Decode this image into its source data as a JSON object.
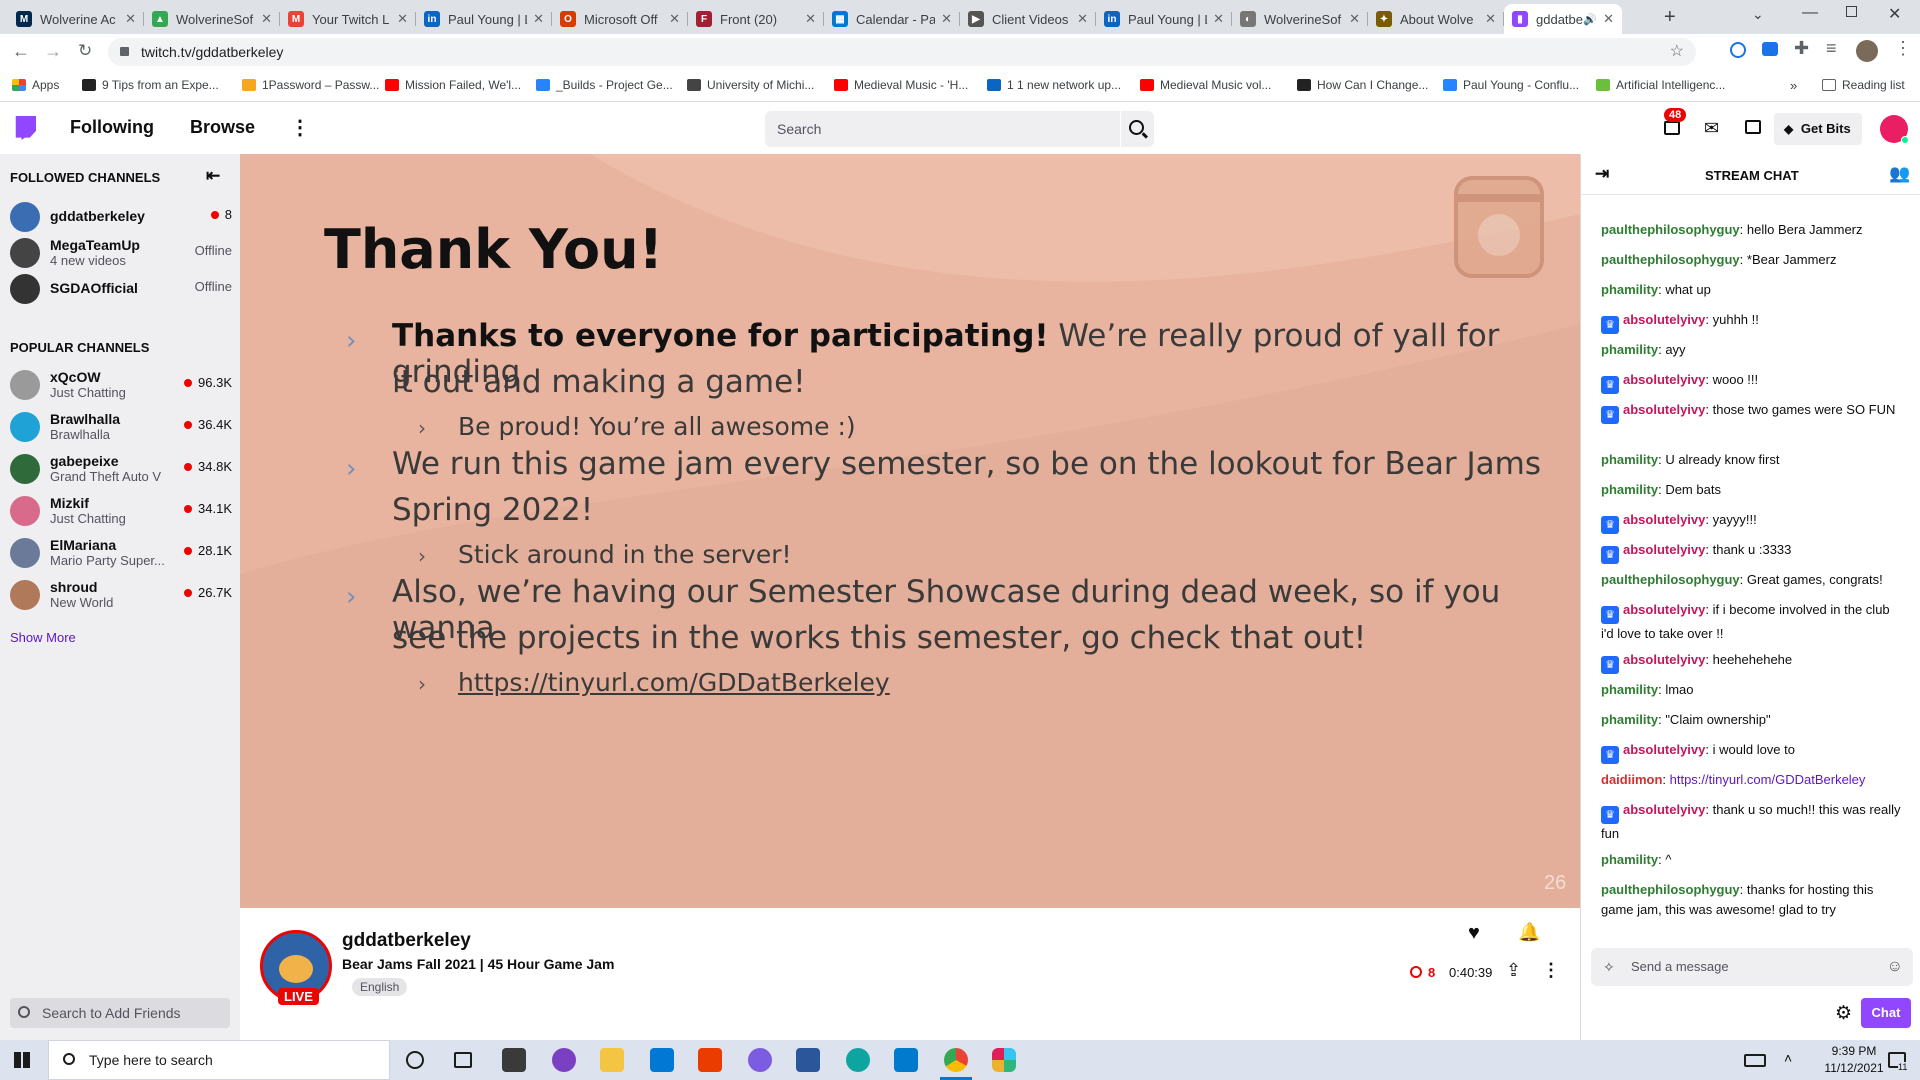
{
  "browser": {
    "tabs": [
      {
        "title": "Wolverine Ac",
        "color": "#00274c",
        "glyph": "M"
      },
      {
        "title": "WolverineSof",
        "color": "#34a853",
        "glyph": "▲"
      },
      {
        "title": "Your Twitch L",
        "color": "#ea4335",
        "glyph": "M"
      },
      {
        "title": "Paul Young | L",
        "color": "#0a66c2",
        "glyph": "in"
      },
      {
        "title": "Microsoft Off",
        "color": "#d83b01",
        "glyph": "O"
      },
      {
        "title": "Front (20)",
        "color": "#a31f34",
        "glyph": "F"
      },
      {
        "title": "Calendar - Pa",
        "color": "#0078d4",
        "glyph": "▦"
      },
      {
        "title": "Client Videos",
        "color": "#555555",
        "glyph": "▶"
      },
      {
        "title": "Paul Young | L",
        "color": "#0a66c2",
        "glyph": "in"
      },
      {
        "title": "WolverineSof",
        "color": "#777777",
        "glyph": "◐"
      },
      {
        "title": "About Wolve",
        "color": "#7a5c00",
        "glyph": "✦"
      },
      {
        "title": "gddatbe",
        "color": "#9147ff",
        "glyph": "▮"
      }
    ],
    "url": "twitch.tv/gddatberkeley",
    "apps_label": "Apps",
    "bookmarks": [
      {
        "label": "9 Tips from an Expe...",
        "color": "#222222"
      },
      {
        "label": "1Password – Passw...",
        "color": "#f5a623"
      },
      {
        "label": "Mission Failed, We'l...",
        "color": "#ff0000"
      },
      {
        "label": "_Builds - Project Ge...",
        "color": "#2684ff"
      },
      {
        "label": "University of Michi...",
        "color": "#444444"
      },
      {
        "label": "Medieval Music - 'H...",
        "color": "#ff0000"
      },
      {
        "label": "1 1 new network up...",
        "color": "#0a66c2"
      },
      {
        "label": "Medieval Music vol...",
        "color": "#ff0000"
      },
      {
        "label": "How Can I Change...",
        "color": "#222222"
      },
      {
        "label": "Paul Young - Conflu...",
        "color": "#2684ff"
      },
      {
        "label": "Artificial Intelligenc...",
        "color": "#6cbf3c"
      }
    ],
    "reading_list": "Reading list"
  },
  "twitch_nav": {
    "following": "Following",
    "browse": "Browse",
    "search_placeholder": "Search",
    "notifications_count": "48",
    "get_bits": "Get Bits"
  },
  "sidebar": {
    "followed_header": "FOLLOWED CHANNELS",
    "followed": [
      {
        "name": "gddatberkeley",
        "sub": "",
        "viewers": "8",
        "live": true,
        "color": "#3b6db3"
      },
      {
        "name": "MegaTeamUp",
        "sub": "4 new videos",
        "viewers": "Offline",
        "live": false,
        "color": "#444444"
      },
      {
        "name": "SGDAOfficial",
        "sub": "",
        "viewers": "Offline",
        "live": false,
        "color": "#333333"
      }
    ],
    "popular_header": "POPULAR CHANNELS",
    "popular": [
      {
        "name": "xQcOW",
        "sub": "Just Chatting",
        "viewers": "96.3K",
        "color": "#9a9a9a"
      },
      {
        "name": "Brawlhalla",
        "sub": "Brawlhalla",
        "viewers": "36.4K",
        "color": "#1fa2d6"
      },
      {
        "name": "gabepeixe",
        "sub": "Grand Theft Auto V",
        "viewers": "34.8K",
        "color": "#2f6b3a"
      },
      {
        "name": "Mizkif",
        "sub": "Just Chatting",
        "viewers": "34.1K",
        "color": "#d86a8c"
      },
      {
        "name": "ElMariana",
        "sub": "Mario Party Super...",
        "viewers": "28.1K",
        "color": "#6b7a99"
      },
      {
        "name": "shroud",
        "sub": "New World",
        "viewers": "26.7K",
        "color": "#b07a5a"
      }
    ],
    "show_more": "Show More",
    "friends_placeholder": "Search to Add Friends"
  },
  "slide": {
    "title": "Thank You!",
    "bullet1_bold": "Thanks to everyone for participating!",
    "bullet1_rest": " We’re really proud of yall for grinding",
    "bullet1_line2": "it out and making a game!",
    "sub1": "Be proud! You’re all awesome :)",
    "bullet2_line1": "We run this game jam every semester, so be on the lookout for Bear Jams",
    "bullet2_line2": "Spring 2022!",
    "sub2": "Stick around in the server!",
    "bullet3_line1": "Also, we’re having our Semester Showcase during dead week, so if you wanna",
    "bullet3_line2": "see the projects in the works this semester, go check that out!",
    "sub3": "https://tinyurl.com/GDDatBerkeley",
    "page_number": "26"
  },
  "stream_info": {
    "channel": "gddatberkeley",
    "title": "Bear Jams Fall 2021 | 45 Hour Game Jam",
    "tag": "English",
    "live_badge": "LIVE",
    "viewers": "8",
    "uptime": "0:40:39"
  },
  "chat": {
    "header": "STREAM CHAT",
    "messages": [
      {
        "user": "paulthephilosophyguy",
        "color": "#2e7d32",
        "badge": false,
        "text": "hello Bera Jammerz"
      },
      {
        "user": "paulthephilosophyguy",
        "color": "#2e7d32",
        "badge": false,
        "text": "*Bear Jammerz"
      },
      {
        "user": "phamility",
        "color": "#2e7d32",
        "badge": false,
        "text": "what up"
      },
      {
        "user": "absolutelyivy",
        "color": "#c2185b",
        "badge": true,
        "text": "yuhhh !!"
      },
      {
        "user": "phamility",
        "color": "#2e7d32",
        "badge": false,
        "text": "ayy"
      },
      {
        "user": "absolutelyivy",
        "color": "#c2185b",
        "badge": true,
        "text": "wooo !!!"
      },
      {
        "user": "absolutelyivy",
        "color": "#c2185b",
        "badge": true,
        "text": "those two games were SO FUN"
      },
      {
        "user": "phamility",
        "color": "#2e7d32",
        "badge": false,
        "text": "U already know first"
      },
      {
        "user": "phamility",
        "color": "#2e7d32",
        "badge": false,
        "text": "Dem bats"
      },
      {
        "user": "absolutelyivy",
        "color": "#c2185b",
        "badge": true,
        "text": "yayyy!!!"
      },
      {
        "user": "absolutelyivy",
        "color": "#c2185b",
        "badge": true,
        "text": "thank u :3333"
      },
      {
        "user": "paulthephilosophyguy",
        "color": "#2e7d32",
        "badge": false,
        "text": "Great games, congrats!"
      },
      {
        "user": "absolutelyivy",
        "color": "#c2185b",
        "badge": true,
        "text": "if i become involved in the club i'd love to take over !!"
      },
      {
        "user": "absolutelyivy",
        "color": "#c2185b",
        "badge": true,
        "text": "heehehehehe"
      },
      {
        "user": "phamility",
        "color": "#2e7d32",
        "badge": false,
        "text": "lmao"
      },
      {
        "user": "phamility",
        "color": "#2e7d32",
        "badge": false,
        "text": "\"Claim ownership\""
      },
      {
        "user": "absolutelyivy",
        "color": "#c2185b",
        "badge": true,
        "text": "i would love to"
      },
      {
        "user": "daidiimon",
        "color": "#d32f2f",
        "badge": false,
        "text": "https://tinyurl.com/GDDatBerkeley",
        "link": true
      },
      {
        "user": "absolutelyivy",
        "color": "#c2185b",
        "badge": true,
        "text": "thank u so much!! this was really fun"
      },
      {
        "user": "phamility",
        "color": "#2e7d32",
        "badge": false,
        "text": "^"
      },
      {
        "user": "paulthephilosophyguy",
        "color": "#2e7d32",
        "badge": false,
        "text": "thanks for hosting this game jam, this was awesome! glad to try"
      }
    ],
    "input_placeholder": "Send a message",
    "chat_button": "Chat"
  },
  "taskbar": {
    "search_placeholder": "Type here to search",
    "time": "9:39 PM",
    "date": "11/12/2021",
    "notif_count": "11"
  },
  "colors": {
    "twitch_purple": "#9147ff",
    "live_red": "#eb0400",
    "slide_bg": "#e8b4a0"
  }
}
